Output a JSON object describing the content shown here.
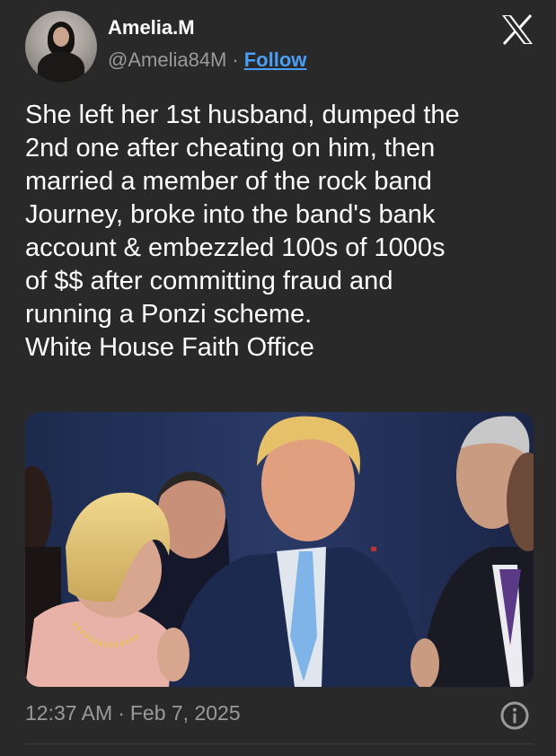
{
  "author": {
    "display_name": "Amelia.M",
    "handle": "@Amelia84M",
    "separator": "·",
    "follow_label": "Follow"
  },
  "brand_icon": "x-logo-icon",
  "tweet": {
    "lines": [
      "She left her 1st husband, dumped the",
      "2nd one after cheating on him, then",
      "married a member of the rock band",
      "Journey, broke into the band's bank",
      "account & embezzled 100s of 1000s",
      "of $$ after committing fraud and",
      "running a Ponzi scheme.",
      "White House Faith Office"
    ]
  },
  "media": {
    "kind": "photo"
  },
  "meta": {
    "time": "12:37 AM",
    "separator": "·",
    "date": "Feb 7, 2025",
    "info_icon": "info-icon"
  },
  "colors": {
    "background": "#292929",
    "text_primary": "#ffffff",
    "text_secondary": "#9a9a9a",
    "link": "#4a9ff5"
  }
}
